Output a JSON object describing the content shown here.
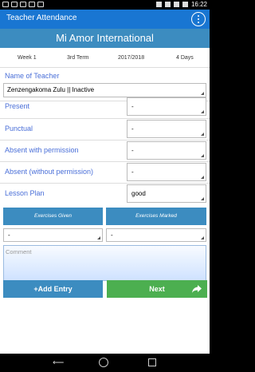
{
  "status": {
    "time": "16:22"
  },
  "appbar": {
    "title": "Teacher Attendance"
  },
  "school": {
    "name": "Mi Amor International"
  },
  "info": {
    "week": "Week 1",
    "term": "3rd Term",
    "year": "2017/2018",
    "days": "4 Days"
  },
  "teacher": {
    "label": "Name of Teacher",
    "selected": "Zenzengakoma Zulu  ||  Inactive"
  },
  "fields": [
    {
      "label": "Present",
      "value": "-"
    },
    {
      "label": "Punctual",
      "value": "-"
    },
    {
      "label": "Absent with permission",
      "value": "-"
    },
    {
      "label": "Absent (without permission)",
      "value": "-"
    },
    {
      "label": "Lesson Plan",
      "value": "good"
    }
  ],
  "exercises": {
    "given_label": "Exercises Given",
    "marked_label": "Exercises Marked",
    "given_value": "-",
    "marked_value": "-"
  },
  "comment": {
    "placeholder": "Comment"
  },
  "buttons": {
    "add": "+Add Entry",
    "next": "Next"
  },
  "colors": {
    "appbar": "#1976d2",
    "header": "#3c8cc0",
    "next": "#4caf50",
    "label": "#4a6fd8"
  }
}
